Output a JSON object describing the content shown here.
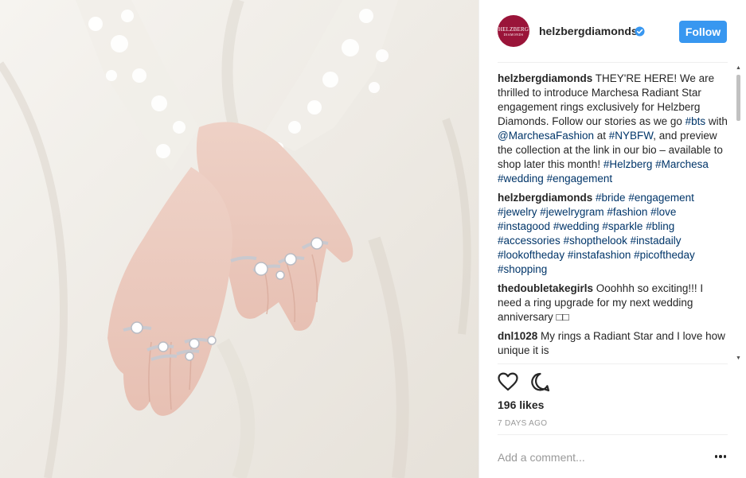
{
  "post": {
    "photo_alt": "",
    "account": {
      "username": "helzbergdiamonds",
      "avatar_line1": "HELZBERG",
      "avatar_line2": "DIAMONDS",
      "verified": true,
      "follow_label": "Follow"
    },
    "comments": [
      {
        "user": "helzbergdiamonds",
        "segments": [
          {
            "t": " THEY'RE HERE! We are thrilled to introduce Marchesa Radiant Star engagement rings exclusively for Helzberg Diamonds. Follow our stories as we go "
          },
          {
            "t": "#bts",
            "tag": true
          },
          {
            "t": " with "
          },
          {
            "t": "@MarchesaFashion",
            "tag": true
          },
          {
            "t": " at "
          },
          {
            "t": "#NYBFW",
            "tag": true
          },
          {
            "t": ", and preview the collection at the link in our bio – available to shop later this month! "
          },
          {
            "t": "#Helzberg",
            "tag": true
          },
          {
            "t": " "
          },
          {
            "t": "#Marchesa",
            "tag": true
          },
          {
            "t": " "
          },
          {
            "t": "#wedding",
            "tag": true
          },
          {
            "t": " "
          },
          {
            "t": "#engagement",
            "tag": true
          }
        ]
      },
      {
        "user": "helzbergdiamonds",
        "segments": [
          {
            "t": " "
          },
          {
            "t": "#bride",
            "tag": true
          },
          {
            "t": " "
          },
          {
            "t": "#engagement",
            "tag": true
          },
          {
            "t": " "
          },
          {
            "t": "#jewelry",
            "tag": true
          },
          {
            "t": " "
          },
          {
            "t": "#jewelrygram",
            "tag": true
          },
          {
            "t": " "
          },
          {
            "t": "#fashion",
            "tag": true
          },
          {
            "t": " "
          },
          {
            "t": "#love",
            "tag": true
          },
          {
            "t": " "
          },
          {
            "t": "#instagood",
            "tag": true
          },
          {
            "t": " "
          },
          {
            "t": "#wedding",
            "tag": true
          },
          {
            "t": " "
          },
          {
            "t": "#sparkle",
            "tag": true
          },
          {
            "t": " "
          },
          {
            "t": "#bling",
            "tag": true
          },
          {
            "t": " "
          },
          {
            "t": "#accessories",
            "tag": true
          },
          {
            "t": " "
          },
          {
            "t": "#shopthelook",
            "tag": true
          },
          {
            "t": " "
          },
          {
            "t": "#instadaily",
            "tag": true
          },
          {
            "t": " "
          },
          {
            "t": "#lookoftheday",
            "tag": true
          },
          {
            "t": " "
          },
          {
            "t": "#instafashion",
            "tag": true
          },
          {
            "t": " "
          },
          {
            "t": "#picoftheday",
            "tag": true
          },
          {
            "t": " "
          },
          {
            "t": "#shopping",
            "tag": true
          }
        ]
      },
      {
        "user": "thedoubletakegirls",
        "segments": [
          {
            "t": " Ooohhh so exciting!!! I need a ring upgrade for my next wedding anniversary □□"
          }
        ]
      },
      {
        "user": "dnl1028",
        "segments": [
          {
            "t": " My rings a Radiant Star and I love how unique it is"
          }
        ]
      }
    ],
    "actions": {
      "like_icon": "heart-icon",
      "comment_icon": "comment-icon"
    },
    "likes": "196 likes",
    "time_ago": "7 DAYS AGO",
    "add_comment_placeholder": "Add a comment...",
    "more_icon": "more-options-icon"
  },
  "colors": {
    "follow_button": "#3897f0",
    "hashtag": "#003569",
    "avatar_bg": "#9a1439",
    "verified_badge": "#3897f0"
  }
}
